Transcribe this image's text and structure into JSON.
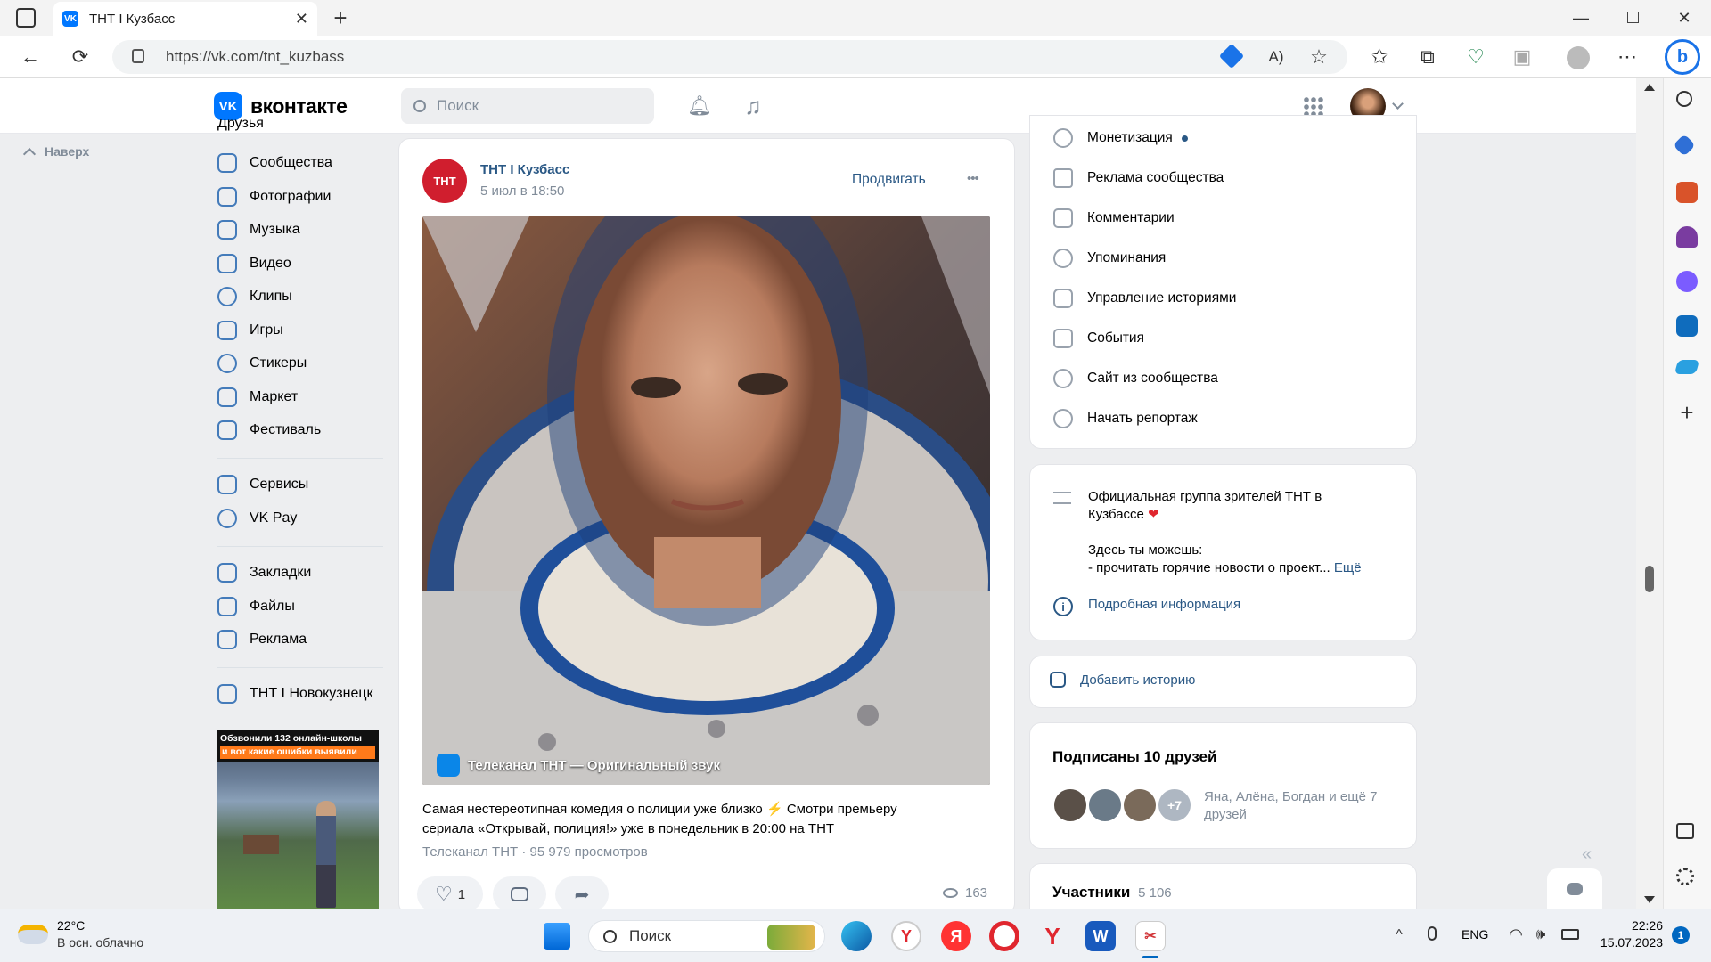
{
  "browser": {
    "tab_title": "ТНТ I Кузбасс",
    "url": "https://vk.com/tnt_kuzbass"
  },
  "vk": {
    "logo_text": "вконтакте",
    "search_placeholder": "Поиск",
    "brand_color": "#0077ff",
    "up_link": "Наверх"
  },
  "left_menu": {
    "partial_top": "Друзья",
    "items": [
      "Сообщества",
      "Фотографии",
      "Музыка",
      "Видео",
      "Клипы",
      "Игры",
      "Стикеры",
      "Маркет",
      "Фестиваль"
    ],
    "items2": [
      "Сервисы",
      "VK Pay"
    ],
    "items3": [
      "Закладки",
      "Файлы",
      "Реклама"
    ],
    "items4": [
      "ТНТ I Новокузнецк"
    ],
    "ad_text_line1": "Обзвонили 132 онлайн-школы",
    "ad_text_line2": "и вот какие ошибки выявили"
  },
  "post": {
    "author": "ТНТ I Кузбасс",
    "date": "5 июл в 18:50",
    "promote": "Продвигать",
    "more": "•••",
    "audio_label": "Телеканал ТНТ — Оригинальный звук",
    "text_line1": "Самая нестереотипная комедия о полиции уже близко",
    "text_line1b": "Смотри премьеру",
    "text_line2": "сериала «Открывай, полиция!» уже в понедельник в 20:00 на ТНТ",
    "meta": "Телеканал ТНТ · 95 979 просмотров",
    "likes": "1",
    "views": "163",
    "avatar_text": "ТНТ"
  },
  "right_menu": {
    "items": [
      "Монетизация",
      "Реклама сообщества",
      "Комментарии",
      "Упоминания",
      "Управление историями",
      "События",
      "Сайт из сообщества",
      "Начать репортаж"
    ]
  },
  "about": {
    "line1": "Официальная группа зрителей ТНТ в",
    "line2": "Кузбассе",
    "line3": "Здесь ты можешь:",
    "line4": "- прочитать горячие новости о проект...",
    "more": "Ещё",
    "info_link": "Подробная информация"
  },
  "story": {
    "label": "Добавить историю"
  },
  "friends": {
    "title": "Подписаны 10 друзей",
    "plus": "+7",
    "names_line1": "Яна, Алёна, Богдан и ещё 7",
    "names_line2": "друзей"
  },
  "members": {
    "title": "Участники",
    "count": "5 106"
  },
  "taskbar": {
    "temp": "22°C",
    "weather": "В осн. облачно",
    "search": "Поиск",
    "lang": "ENG",
    "time": "22:26",
    "date": "15.07.2023",
    "notif": "1"
  }
}
